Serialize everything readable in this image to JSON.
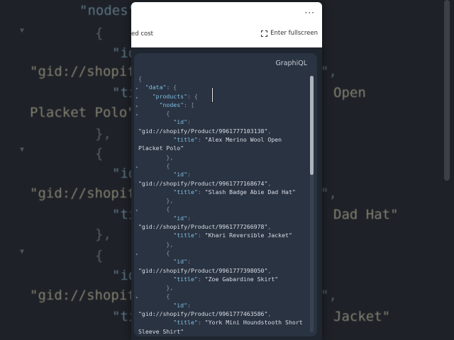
{
  "background": {
    "lines": [
      {
        "t": "\"nodes\"",
        "cls": "bg-key"
      },
      {
        "t": "{",
        "cls": "bg-punc"
      },
      {
        "t": "\"id",
        "cls": "bg-key"
      },
      {
        "t": "\"gid://shopif",
        "cls": "bg-str"
      },
      {
        "t": "\"ti",
        "cls": "bg-key"
      },
      {
        "t": "Open",
        "cls": "bg-str"
      },
      {
        "t": "Placket Polo\"",
        "cls": "bg-str"
      },
      {
        "t": "},",
        "cls": "bg-punc"
      },
      {
        "t": "{",
        "cls": "bg-punc"
      },
      {
        "t": "\"id",
        "cls": "bg-key"
      },
      {
        "t": "\"gid://shopif",
        "cls": "bg-str"
      },
      {
        "t": "\"ti",
        "cls": "bg-key"
      },
      {
        "t": "Dad Hat\"",
        "cls": "bg-str"
      },
      {
        "t": "},",
        "cls": "bg-punc"
      },
      {
        "t": "{",
        "cls": "bg-punc"
      },
      {
        "t": "\"id",
        "cls": "bg-key"
      },
      {
        "t": "\"gid://shopif",
        "cls": "bg-str"
      },
      {
        "t": "\"ti",
        "cls": "bg-key"
      },
      {
        "t": "Jacket\"",
        "cls": "bg-str"
      },
      {
        "t": "\",",
        "cls": "bg-punc"
      },
      {
        "t": "\",",
        "cls": "bg-punc"
      },
      {
        "t": "\",",
        "cls": "bg-punc"
      }
    ]
  },
  "panel": {
    "more_label": "···",
    "cost_text": "ed cost",
    "fullscreen_label": "Enter fullscreen",
    "card_label": "GraphiQL"
  },
  "code_lines": [
    [
      {
        "c": "p",
        "t": "{"
      }
    ],
    [
      {
        "c": "p",
        "t": "  "
      },
      {
        "c": "k",
        "t": "\"data\""
      },
      {
        "c": "p",
        "t": ": {"
      }
    ],
    [
      {
        "c": "p",
        "t": "    "
      },
      {
        "c": "k",
        "t": "\"products\""
      },
      {
        "c": "p",
        "t": ": {"
      }
    ],
    [
      {
        "c": "p",
        "t": "      "
      },
      {
        "c": "k",
        "t": "\"nodes\""
      },
      {
        "c": "p",
        "t": ": ["
      }
    ],
    [
      {
        "c": "p",
        "t": "        {"
      }
    ],
    [
      {
        "c": "p",
        "t": "          "
      },
      {
        "c": "k",
        "t": "\"id\""
      },
      {
        "c": "p",
        "t": ":"
      }
    ],
    [
      {
        "c": "s",
        "t": "\"gid://shopify/Product/9961777103138\""
      },
      {
        "c": "p",
        "t": ","
      }
    ],
    [
      {
        "c": "p",
        "t": "          "
      },
      {
        "c": "k",
        "t": "\"title\""
      },
      {
        "c": "p",
        "t": ": "
      },
      {
        "c": "s",
        "t": "\"Alex Merino Wool Open"
      }
    ],
    [
      {
        "c": "s",
        "t": "Placket Polo\""
      }
    ],
    [
      {
        "c": "p",
        "t": "        },"
      }
    ],
    [
      {
        "c": "p",
        "t": "        {"
      }
    ],
    [
      {
        "c": "p",
        "t": "          "
      },
      {
        "c": "k",
        "t": "\"id\""
      },
      {
        "c": "p",
        "t": ":"
      }
    ],
    [
      {
        "c": "s",
        "t": "\"gid://shopify/Product/9961777168674\""
      },
      {
        "c": "p",
        "t": ","
      }
    ],
    [
      {
        "c": "p",
        "t": "          "
      },
      {
        "c": "k",
        "t": "\"title\""
      },
      {
        "c": "p",
        "t": ": "
      },
      {
        "c": "s",
        "t": "\"Slash Badge Abie Dad Hat\""
      }
    ],
    [
      {
        "c": "p",
        "t": "        },"
      }
    ],
    [
      {
        "c": "p",
        "t": "        {"
      }
    ],
    [
      {
        "c": "p",
        "t": "          "
      },
      {
        "c": "k",
        "t": "\"id\""
      },
      {
        "c": "p",
        "t": ":"
      }
    ],
    [
      {
        "c": "s",
        "t": "\"gid://shopify/Product/9961777266978\""
      },
      {
        "c": "p",
        "t": ","
      }
    ],
    [
      {
        "c": "p",
        "t": "          "
      },
      {
        "c": "k",
        "t": "\"title\""
      },
      {
        "c": "p",
        "t": ": "
      },
      {
        "c": "s",
        "t": "\"Khari Reversible Jacket\""
      }
    ],
    [
      {
        "c": "p",
        "t": "        },"
      }
    ],
    [
      {
        "c": "p",
        "t": "        {"
      }
    ],
    [
      {
        "c": "p",
        "t": "          "
      },
      {
        "c": "k",
        "t": "\"id\""
      },
      {
        "c": "p",
        "t": ":"
      }
    ],
    [
      {
        "c": "s",
        "t": "\"gid://shopify/Product/9961777398050\""
      },
      {
        "c": "p",
        "t": ","
      }
    ],
    [
      {
        "c": "p",
        "t": "          "
      },
      {
        "c": "k",
        "t": "\"title\""
      },
      {
        "c": "p",
        "t": ": "
      },
      {
        "c": "s",
        "t": "\"Zoe Gabardine Skirt\""
      }
    ],
    [
      {
        "c": "p",
        "t": "        },"
      }
    ],
    [
      {
        "c": "p",
        "t": "        {"
      }
    ],
    [
      {
        "c": "p",
        "t": "          "
      },
      {
        "c": "k",
        "t": "\"id\""
      },
      {
        "c": "p",
        "t": ":"
      }
    ],
    [
      {
        "c": "s",
        "t": "\"gid://shopify/Product/9961777463586\""
      },
      {
        "c": "p",
        "t": ","
      }
    ],
    [
      {
        "c": "p",
        "t": "          "
      },
      {
        "c": "k",
        "t": "\"title\""
      },
      {
        "c": "p",
        "t": ": "
      },
      {
        "c": "s",
        "t": "\"York Mini Houndstooth Short"
      }
    ],
    [
      {
        "c": "s",
        "t": "Sleeve Shirt\""
      }
    ]
  ],
  "colors": {
    "key": "#7fbfe2",
    "string": "#d8dde6",
    "card_bg": "#2a3342",
    "panel_bg": "#1f2630"
  }
}
